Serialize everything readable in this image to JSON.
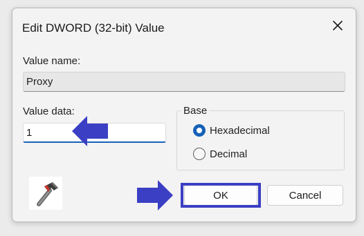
{
  "dialog": {
    "title": "Edit DWORD (32-bit) Value",
    "close_icon": "close-icon"
  },
  "value_name": {
    "label": "Value name:",
    "value": "Proxy"
  },
  "value_data": {
    "label": "Value data:",
    "value": "1"
  },
  "base": {
    "legend": "Base",
    "options": [
      {
        "label": "Hexadecimal",
        "checked": true
      },
      {
        "label": "Decimal",
        "checked": false
      }
    ]
  },
  "buttons": {
    "ok_label": "OK",
    "cancel_label": "Cancel"
  },
  "annotations": {
    "arrow_color": "#3b3fc4",
    "highlight_color": "#3b3fc4",
    "logo_icon": "hammer-icon"
  },
  "colors": {
    "accent": "#1661b8"
  }
}
